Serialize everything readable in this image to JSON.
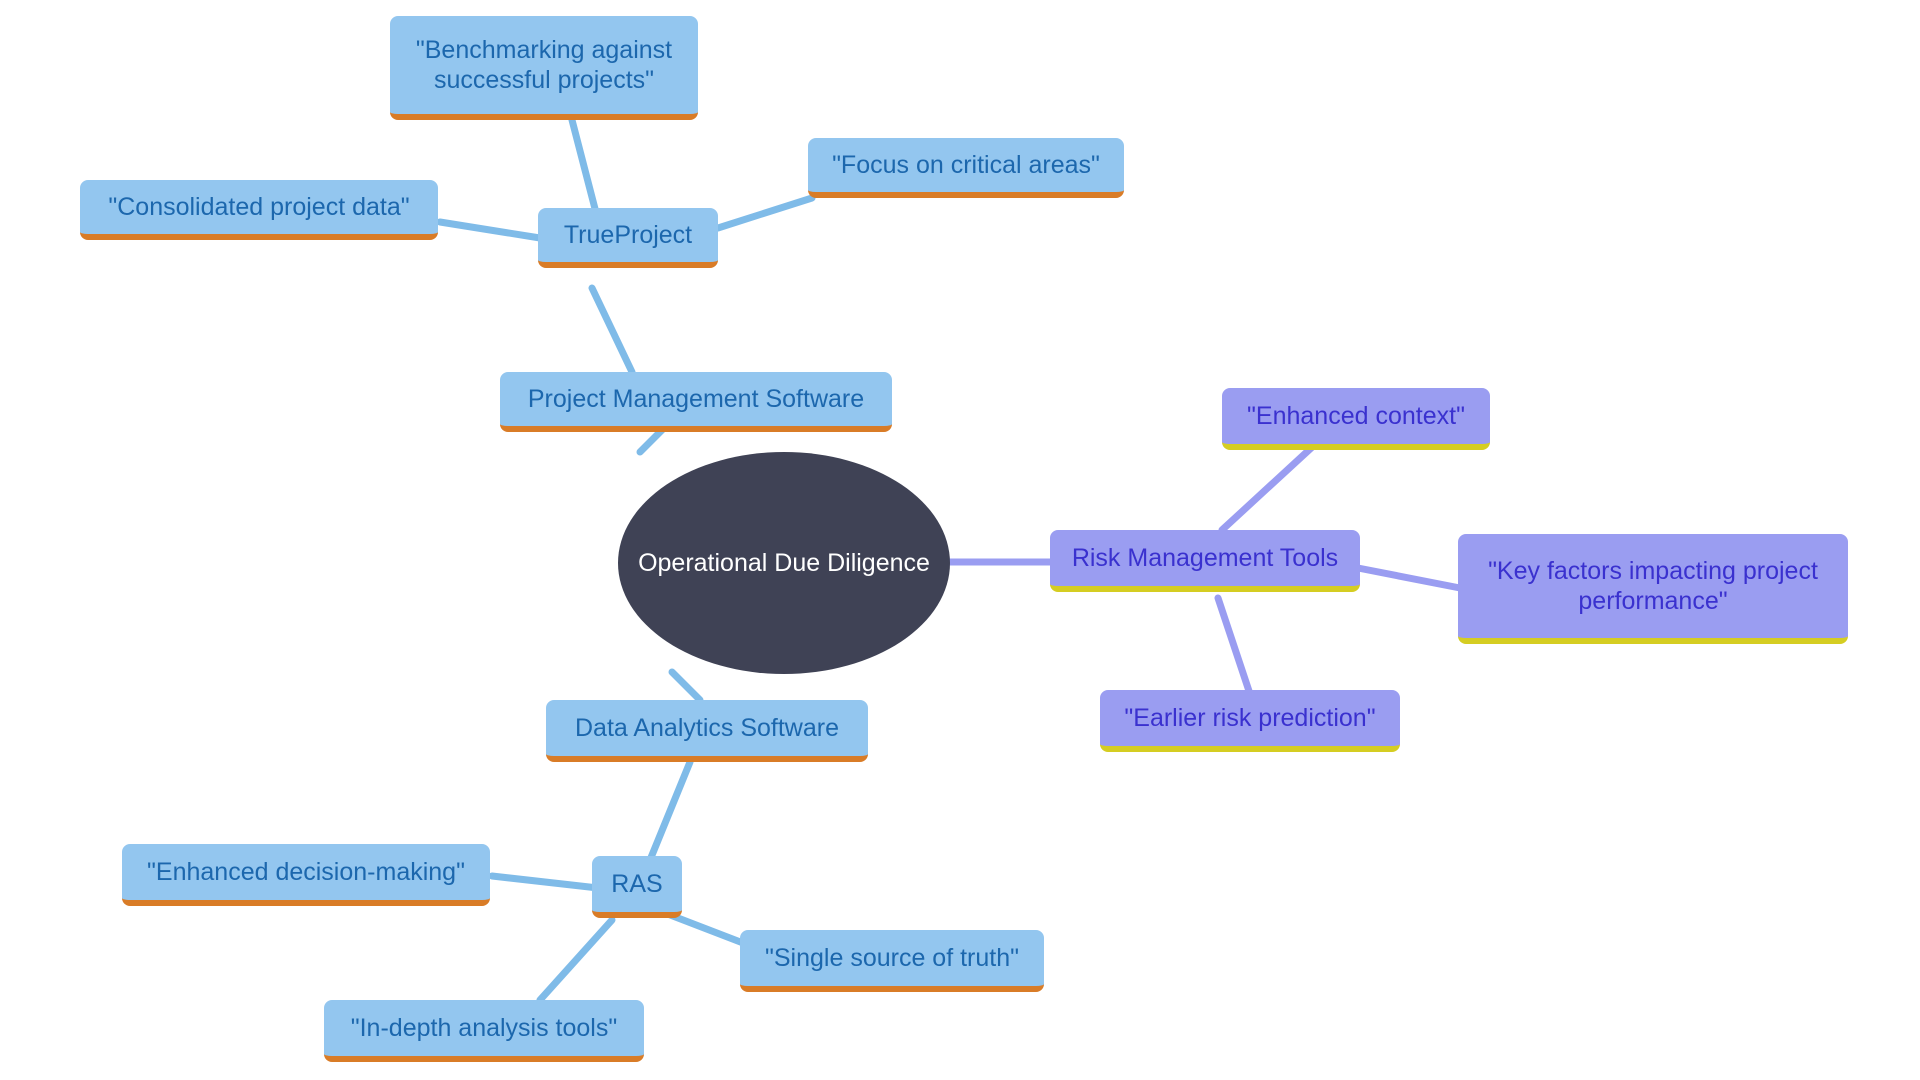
{
  "diagram": {
    "title": "Operational Due Diligence",
    "type": "mind-map",
    "background": "#ffffff",
    "palette": {
      "root_fill": "#3f4255",
      "root_text": "#ffffff",
      "blue_fill": "#93c6ef",
      "blue_text": "#1c67ad",
      "blue_accent": "#d97c27",
      "blue_edge": "#7fbbe8",
      "purple_fill": "#9a9df1",
      "purple_text": "#3a31cf",
      "purple_accent": "#d5cd22",
      "purple_edge": "#9a9df1"
    }
  },
  "nodes": {
    "root": {
      "label": "Operational Due Diligence"
    },
    "project_management_software": {
      "label": "Project Management Software"
    },
    "trueproject": {
      "label": "TrueProject"
    },
    "consolidated_project_data": {
      "label": "\"Consolidated project data\""
    },
    "benchmarking": {
      "label": "\"Benchmarking against\nsuccessful projects\""
    },
    "focus_critical_areas": {
      "label": "\"Focus on critical areas\""
    },
    "risk_management_tools": {
      "label": "Risk Management Tools"
    },
    "enhanced_context": {
      "label": "\"Enhanced context\""
    },
    "key_factors": {
      "label": "\"Key factors impacting project\nperformance\""
    },
    "earlier_risk_prediction": {
      "label": "\"Earlier risk prediction\""
    },
    "data_analytics_software": {
      "label": "Data Analytics Software"
    },
    "ras": {
      "label": "RAS"
    },
    "enhanced_decision_making": {
      "label": "\"Enhanced decision-making\""
    },
    "in_depth_analysis_tools": {
      "label": "\"In-depth analysis tools\""
    },
    "single_source_of_truth": {
      "label": "\"Single source of truth\""
    }
  },
  "chart_data": {
    "type": "diagram",
    "title": "Operational Due Diligence",
    "root": "Operational Due Diligence",
    "branches": [
      {
        "name": "Project Management Software",
        "color_family": "blue",
        "children": [
          {
            "name": "TrueProject",
            "children": [
              {
                "name": "\"Consolidated project data\""
              },
              {
                "name": "\"Benchmarking against successful projects\""
              },
              {
                "name": "\"Focus on critical areas\""
              }
            ]
          }
        ]
      },
      {
        "name": "Risk Management Tools",
        "color_family": "purple",
        "children": [
          {
            "name": "\"Enhanced context\""
          },
          {
            "name": "\"Key factors impacting project performance\""
          },
          {
            "name": "\"Earlier risk prediction\""
          }
        ]
      },
      {
        "name": "Data Analytics Software",
        "color_family": "blue",
        "children": [
          {
            "name": "RAS",
            "children": [
              {
                "name": "\"Enhanced decision-making\""
              },
              {
                "name": "\"In-depth analysis tools\""
              },
              {
                "name": "\"Single source of truth\""
              }
            ]
          }
        ]
      }
    ],
    "edges": [
      {
        "from": "Operational Due Diligence",
        "to": "Project Management Software"
      },
      {
        "from": "Project Management Software",
        "to": "TrueProject"
      },
      {
        "from": "TrueProject",
        "to": "\"Consolidated project data\""
      },
      {
        "from": "TrueProject",
        "to": "\"Benchmarking against successful projects\""
      },
      {
        "from": "TrueProject",
        "to": "\"Focus on critical areas\""
      },
      {
        "from": "Operational Due Diligence",
        "to": "Risk Management Tools"
      },
      {
        "from": "Risk Management Tools",
        "to": "\"Enhanced context\""
      },
      {
        "from": "Risk Management Tools",
        "to": "\"Key factors impacting project performance\""
      },
      {
        "from": "Risk Management Tools",
        "to": "\"Earlier risk prediction\""
      },
      {
        "from": "Operational Due Diligence",
        "to": "Data Analytics Software"
      },
      {
        "from": "Data Analytics Software",
        "to": "RAS"
      },
      {
        "from": "RAS",
        "to": "\"Enhanced decision-making\""
      },
      {
        "from": "RAS",
        "to": "\"In-depth analysis tools\""
      },
      {
        "from": "RAS",
        "to": "\"Single source of truth\""
      }
    ]
  }
}
